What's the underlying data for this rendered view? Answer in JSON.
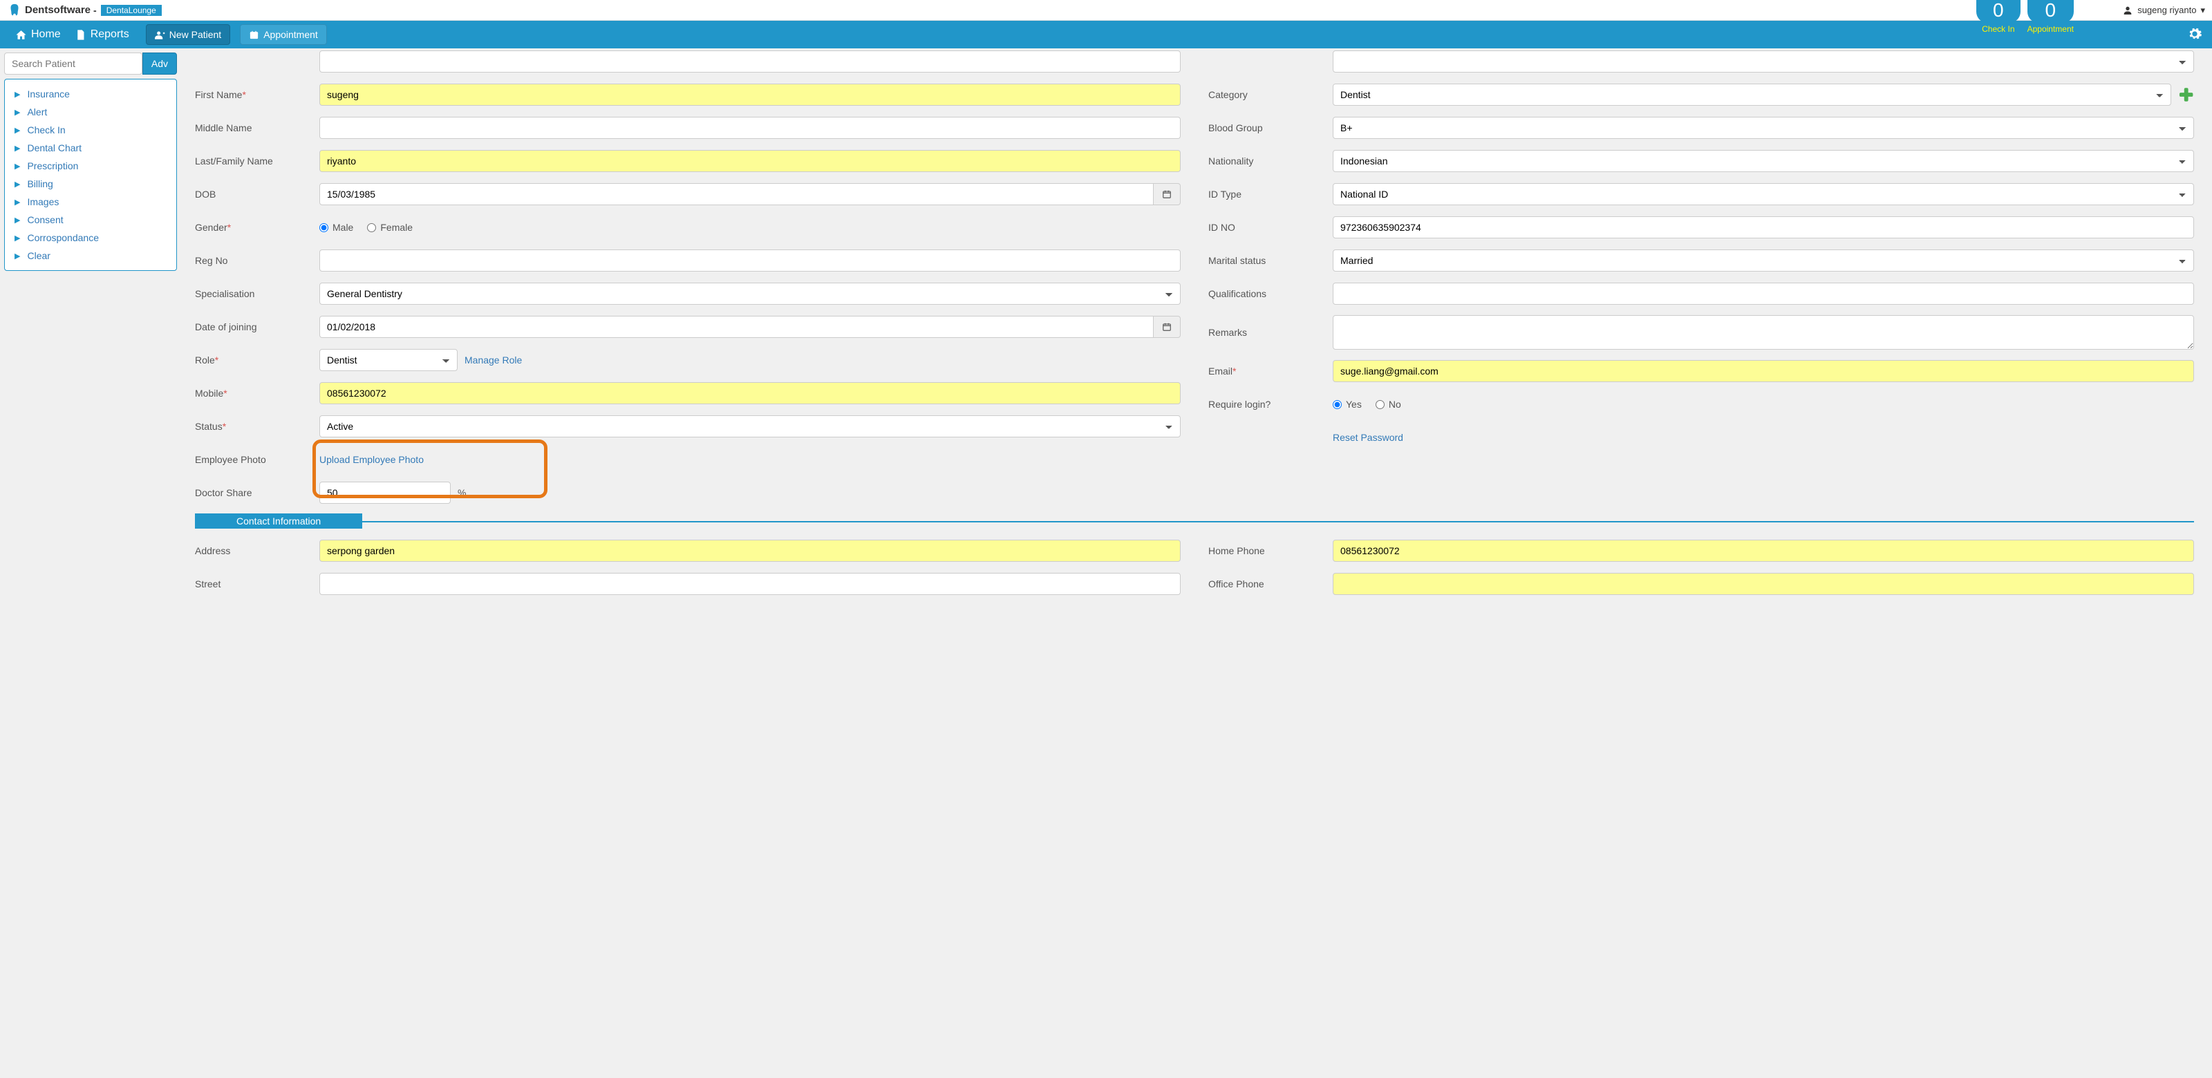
{
  "brand": {
    "name": "Dentsoftware",
    "dash": "-",
    "badge": "DentaLounge"
  },
  "user": {
    "name": "sugeng riyanto"
  },
  "counters": {
    "checkin": {
      "num": "0",
      "label": "Check In"
    },
    "appointment": {
      "num": "0",
      "label": "Appointment"
    }
  },
  "nav": {
    "home": "Home",
    "reports": "Reports",
    "newPatient": "New Patient",
    "appointment": "Appointment"
  },
  "search": {
    "placeholder": "Search Patient",
    "adv": "Adv"
  },
  "sidebar": {
    "items": [
      "Insurance",
      "Alert",
      "Check In",
      "Dental Chart",
      "Prescription",
      "Billing",
      "Images",
      "Consent",
      "Corrospondance",
      "Clear"
    ]
  },
  "form": {
    "left": {
      "firstName": {
        "label": "First Name",
        "value": "sugeng",
        "required": true
      },
      "middleName": {
        "label": "Middle Name",
        "value": ""
      },
      "lastName": {
        "label": "Last/Family Name",
        "value": "riyanto"
      },
      "dob": {
        "label": "DOB",
        "value": "15/03/1985"
      },
      "gender": {
        "label": "Gender",
        "male": "Male",
        "female": "Female",
        "selected": "male",
        "required": true
      },
      "regNo": {
        "label": "Reg No",
        "value": ""
      },
      "specialisation": {
        "label": "Specialisation",
        "value": "General Dentistry"
      },
      "doj": {
        "label": "Date of joining",
        "value": "01/02/2018"
      },
      "role": {
        "label": "Role",
        "value": "Dentist",
        "manage": "Manage Role",
        "required": true
      },
      "mobile": {
        "label": "Mobile",
        "value": "08561230072",
        "required": true
      },
      "status": {
        "label": "Status",
        "value": "Active",
        "required": true
      },
      "photo": {
        "label": "Employee Photo",
        "link": "Upload Employee Photo"
      },
      "share": {
        "label": "Doctor Share",
        "value": "50",
        "unit": "%"
      }
    },
    "right": {
      "category": {
        "label": "Category",
        "value": "Dentist"
      },
      "blood": {
        "label": "Blood Group",
        "value": "B+"
      },
      "nationality": {
        "label": "Nationality",
        "value": "Indonesian"
      },
      "idType": {
        "label": "ID Type",
        "value": "National ID"
      },
      "idNo": {
        "label": "ID NO",
        "value": "972360635902374"
      },
      "marital": {
        "label": "Marital status",
        "value": "Married"
      },
      "qual": {
        "label": "Qualifications",
        "value": ""
      },
      "remarks": {
        "label": "Remarks",
        "value": ""
      },
      "email": {
        "label": "Email",
        "value": "suge.liang@gmail.com",
        "required": true
      },
      "login": {
        "label": "Require login?",
        "yes": "Yes",
        "no": "No",
        "selected": "yes"
      },
      "reset": "Reset Password"
    }
  },
  "contact": {
    "header": "Contact Information",
    "address": {
      "label": "Address",
      "value": "serpong garden"
    },
    "street": {
      "label": "Street",
      "value": ""
    },
    "homePhone": {
      "label": "Home Phone",
      "value": "08561230072"
    },
    "officePhone": {
      "label": "Office Phone",
      "value": ""
    }
  }
}
